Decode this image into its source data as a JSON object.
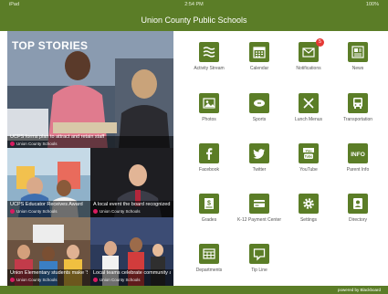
{
  "status_bar": {
    "carrier": "iPad",
    "time": "2:54 PM",
    "battery": "100%"
  },
  "app": {
    "title": "Union County Public Schools"
  },
  "stories": {
    "header": "TOP STORIES",
    "items": [
      {
        "caption": "UCPS forms plan to attract and retain staff",
        "meta": "Union County Schools"
      },
      {
        "caption": "UCPS Educator Receives Award",
        "meta": "Union County Schools"
      },
      {
        "caption": "A local event the board recognized by district staff & students",
        "meta": "Union County Schools"
      },
      {
        "caption": "Union Elementary students make 'Smartest Kids' Reading Challenge",
        "meta": "Union County Schools"
      },
      {
        "caption": "Local teams celebrate community achievements",
        "meta": "Union County Schools"
      }
    ]
  },
  "menu": [
    {
      "label": "Activity Stream",
      "icon": "activity-stream-icon"
    },
    {
      "label": "Calendar",
      "icon": "calendar-icon"
    },
    {
      "label": "Notifications",
      "icon": "envelope-icon",
      "badge": "5"
    },
    {
      "label": "News",
      "icon": "newspaper-icon"
    },
    {
      "label": "Photos",
      "icon": "photo-icon"
    },
    {
      "label": "Sports",
      "icon": "football-icon"
    },
    {
      "label": "Lunch Menus",
      "icon": "fork-knife-icon"
    },
    {
      "label": "Transportation",
      "icon": "bus-icon"
    },
    {
      "label": "Facebook",
      "icon": "facebook-icon"
    },
    {
      "label": "Twitter",
      "icon": "twitter-icon"
    },
    {
      "label": "YouTube",
      "icon": "youtube-icon"
    },
    {
      "label": "Parent Info",
      "icon": "info-icon"
    },
    {
      "label": "Grades",
      "icon": "grades-icon"
    },
    {
      "label": "K-12 Payment Center",
      "icon": "payment-card-icon"
    },
    {
      "label": "Settings",
      "icon": "gear-icon"
    },
    {
      "label": "Directory",
      "icon": "person-icon"
    },
    {
      "label": "Departments",
      "icon": "departments-icon"
    },
    {
      "label": "Tip Line",
      "icon": "chat-bubble-icon"
    }
  ],
  "footer": {
    "left": "",
    "right": "powered by Blackboard"
  },
  "colors": {
    "brand": "#5b7d27",
    "badge": "#e53935"
  }
}
